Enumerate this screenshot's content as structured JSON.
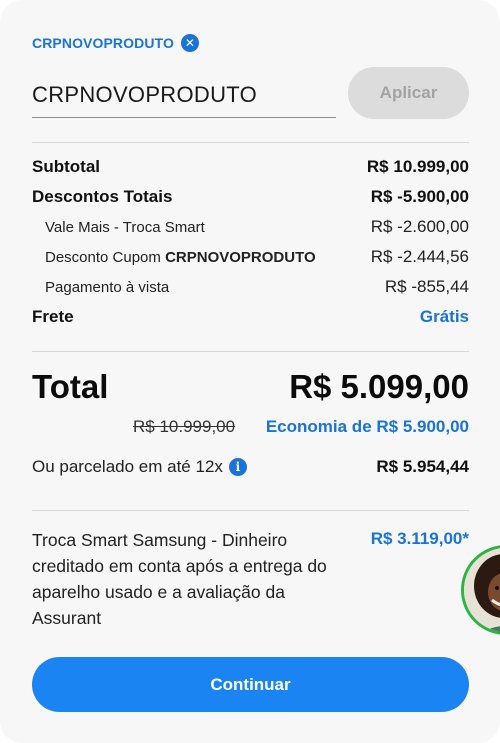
{
  "coupon": {
    "applied_code": "CRPNOVOPRODUTO",
    "input_value": "CRPNOVOPRODUTO",
    "apply_label": "Aplicar"
  },
  "summary": {
    "subtotal_label": "Subtotal",
    "subtotal_value": "R$ 10.999,00",
    "discounts_label": "Descontos Totais",
    "discounts_value": "R$ -5.900,00",
    "discount_items": [
      {
        "label": "Vale Mais - Troca Smart",
        "value": "R$ -2.600,00"
      },
      {
        "label_prefix": "Desconto Cupom ",
        "label_code": "CRPNOVOPRODUTO",
        "value": "R$ -2.444,56"
      },
      {
        "label": "Pagamento à vista",
        "value": "R$ -855,44"
      }
    ],
    "shipping_label": "Frete",
    "shipping_value": "Grátis"
  },
  "total": {
    "label": "Total",
    "value": "R$ 5.099,00",
    "original_price": "R$ 10.999,00",
    "economy": "Economia de R$ 5.900,00",
    "installment_label": "Ou parcelado em até 12x",
    "installment_value": "R$ 5.954,44"
  },
  "trade_in": {
    "text": "Troca Smart Samsung - Dinheiro creditado em conta após a entrega do aparelho usado e a avaliação da Assurant",
    "value": "R$ 3.119,00*"
  },
  "actions": {
    "continue_label": "Continuar"
  },
  "icons": {
    "chip_close": "close-circle-icon",
    "info": "info-icon"
  },
  "colors": {
    "accent": "#1a73d9",
    "primary_button": "#1a84f2",
    "chat_ring": "#2fb344"
  }
}
